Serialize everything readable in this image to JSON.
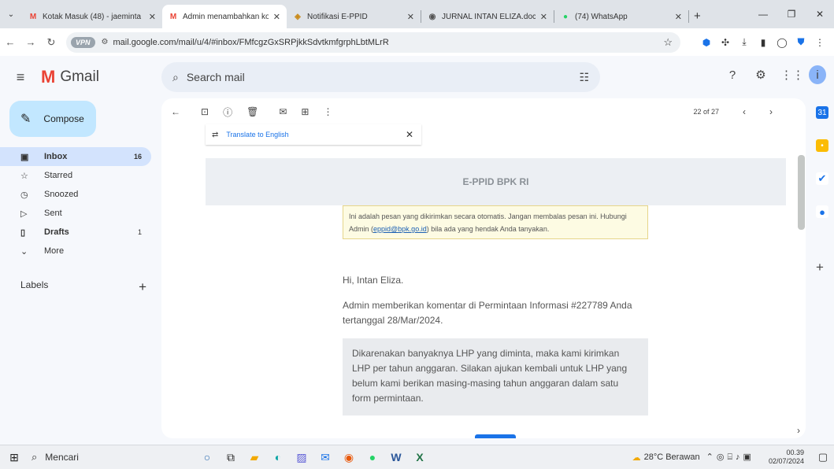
{
  "browser": {
    "tabs": [
      {
        "title": "Kotak Masuk (48) - jaeminta",
        "icon": "gmail-icon",
        "active": false
      },
      {
        "title": "Admin menambahkan kome",
        "icon": "gmail-icon",
        "active": true
      },
      {
        "title": "Notifikasi E-PPID",
        "icon": "eppid-icon",
        "active": false
      },
      {
        "title": "JURNAL INTAN ELIZA.docx.p",
        "icon": "globe-icon",
        "active": false
      },
      {
        "title": "(74) WhatsApp",
        "icon": "whatsapp-icon",
        "active": false
      }
    ],
    "url": "mail.google.com/mail/u/4/#inbox/FMfcgzGxSRPjkkSdvtkmfgrphLbtMLrR",
    "vpn_label": "VPN"
  },
  "gmail": {
    "logo_text": "Gmail",
    "search_placeholder": "Search mail",
    "compose_label": "Compose",
    "nav": [
      {
        "label": "Inbox",
        "count": "16",
        "icon": "inbox-icon",
        "active": true,
        "bold": true
      },
      {
        "label": "Starred",
        "count": "",
        "icon": "star-icon",
        "active": false,
        "bold": false
      },
      {
        "label": "Snoozed",
        "count": "",
        "icon": "clock-icon",
        "active": false,
        "bold": false
      },
      {
        "label": "Sent",
        "count": "",
        "icon": "send-icon",
        "active": false,
        "bold": false
      },
      {
        "label": "Drafts",
        "count": "1",
        "icon": "draft-icon",
        "active": false,
        "bold": true
      },
      {
        "label": "More",
        "count": "",
        "icon": "chevron-down-icon",
        "active": false,
        "bold": false
      }
    ],
    "labels_heading": "Labels",
    "pager": "22 of 27",
    "translate_label": "Translate to English"
  },
  "email": {
    "banner_title": "E-PPID BPK RI",
    "notice_text_1": "Ini adalah pesan yang dikirimkan secara otomatis. Jangan membalas pesan ini. Hubungi Admin (",
    "notice_email": "eppid@bpk.go.id",
    "notice_text_2": ") bila ada yang hendak Anda tanyakan.",
    "greeting": "Hi, Intan Eliza.",
    "comment": "Admin memberikan komentar di Permintaan Informasi #227789 Anda tertanggal 28/Mar/2024.",
    "quote": "Dikarenakan banyaknya LHP yang diminta, maka kami kirimkan LHP per tahun anggaran. Silakan ajukan kembali untuk LHP yang belum kami berikan masing-masing tahun anggaran dalam satu form permintaan."
  },
  "taskbar": {
    "search_label": "Mencari",
    "weather": "28°C Berawan",
    "time": "00.39",
    "date": "02/07/2024"
  }
}
